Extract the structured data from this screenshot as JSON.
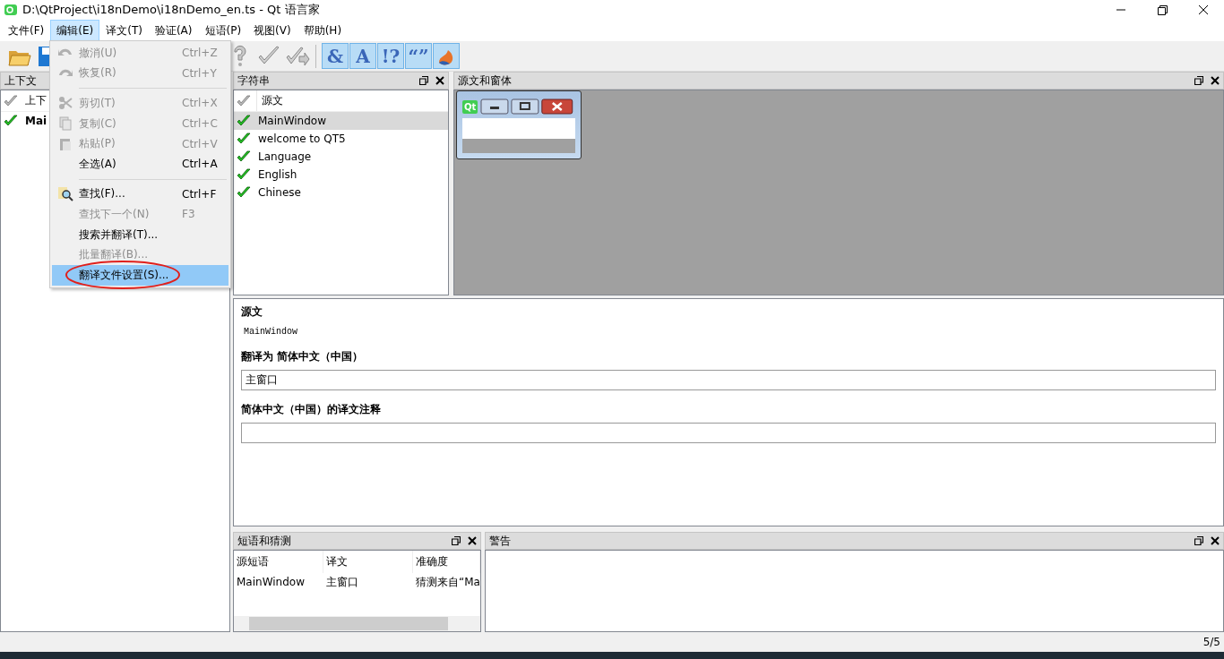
{
  "window": {
    "title": "D:\\QtProject\\i18nDemo\\i18nDemo_en.ts - Qt 语言家"
  },
  "menu_bar": [
    {
      "label": "文件(F)",
      "selected": false
    },
    {
      "label": "编辑(E)",
      "selected": true
    },
    {
      "label": "译文(T)",
      "selected": false
    },
    {
      "label": "验证(A)",
      "selected": false
    },
    {
      "label": "短语(P)",
      "selected": false
    },
    {
      "label": "视图(V)",
      "selected": false
    },
    {
      "label": "帮助(H)",
      "selected": false
    }
  ],
  "toolbar": {
    "left": [
      {
        "kind": "open"
      },
      {
        "kind": "save"
      }
    ],
    "middle": [
      {
        "kind": "question"
      },
      {
        "kind": "check"
      },
      {
        "kind": "next"
      }
    ],
    "toggles": [
      {
        "kind": "glyph",
        "glyph": "&",
        "checked": true
      },
      {
        "kind": "glyph",
        "glyph": "A",
        "checked": true
      },
      {
        "kind": "glyph",
        "glyph": "!?",
        "checked": true
      },
      {
        "kind": "glyph",
        "glyph": "“”",
        "checked": true
      },
      {
        "kind": "flame",
        "checked": true
      }
    ]
  },
  "edit_menu": [
    {
      "kind": "item",
      "label": "撤消(U)",
      "shortcut": "Ctrl+Z",
      "disabled": true,
      "selected": false
    },
    {
      "kind": "item",
      "label": "恢复(R)",
      "shortcut": "Ctrl+Y",
      "disabled": true,
      "selected": false
    },
    {
      "kind": "separator"
    },
    {
      "kind": "item",
      "label": "剪切(T)",
      "shortcut": "Ctrl+X",
      "disabled": true,
      "selected": false
    },
    {
      "kind": "item",
      "label": "复制(C)",
      "shortcut": "Ctrl+C",
      "disabled": true,
      "selected": false
    },
    {
      "kind": "item",
      "label": "粘贴(P)",
      "shortcut": "Ctrl+V",
      "disabled": true,
      "selected": false
    },
    {
      "kind": "item",
      "label": "全选(A)",
      "shortcut": "Ctrl+A",
      "disabled": false,
      "selected": false
    },
    {
      "kind": "separator"
    },
    {
      "kind": "item",
      "label": "查找(F)...",
      "shortcut": "Ctrl+F",
      "disabled": false,
      "selected": false
    },
    {
      "kind": "item",
      "label": "查找下一个(N)",
      "shortcut": "F3",
      "disabled": true,
      "selected": false
    },
    {
      "kind": "item",
      "label": "搜索并翻译(T)...",
      "disabled": false,
      "selected": false
    },
    {
      "kind": "item",
      "label": "批量翻译(B)...",
      "disabled": true,
      "selected": false
    },
    {
      "kind": "item",
      "label": "翻译文件设置(S)...",
      "disabled": false,
      "selected": true,
      "circled": true
    }
  ],
  "context_dock": {
    "title": "上下文",
    "header": "上下",
    "rows": [
      {
        "label": "Mai",
        "done": true,
        "selected": false
      }
    ]
  },
  "strings_dock": {
    "title": "字符串",
    "header": "源文",
    "rows": [
      {
        "label": "MainWindow",
        "done": true,
        "selected": true
      },
      {
        "label": "welcome to QT5",
        "done": true,
        "selected": false
      },
      {
        "label": "Language",
        "done": true,
        "selected": false
      },
      {
        "label": "English",
        "done": true,
        "selected": false
      },
      {
        "label": "Chinese",
        "done": true,
        "selected": false
      }
    ]
  },
  "forms_dock": {
    "title": "源文和窗体",
    "preview": {
      "logo": "Qt"
    }
  },
  "editor": {
    "source_label": "源文",
    "source_text": "MainWindow",
    "translation_label": "翻译为 简体中文（中国）",
    "translation": "主窗口",
    "comment_label": "简体中文（中国）的译文注释"
  },
  "phrases_dock": {
    "title": "短语和猜测",
    "columns": [
      "源短语",
      "译文",
      "准确度"
    ],
    "rows": [
      [
        "MainWindow",
        "主窗口",
        "猜测来自“Ma"
      ]
    ]
  },
  "warnings_dock": {
    "title": "警告"
  },
  "status_bar": {
    "text": "5/5"
  }
}
